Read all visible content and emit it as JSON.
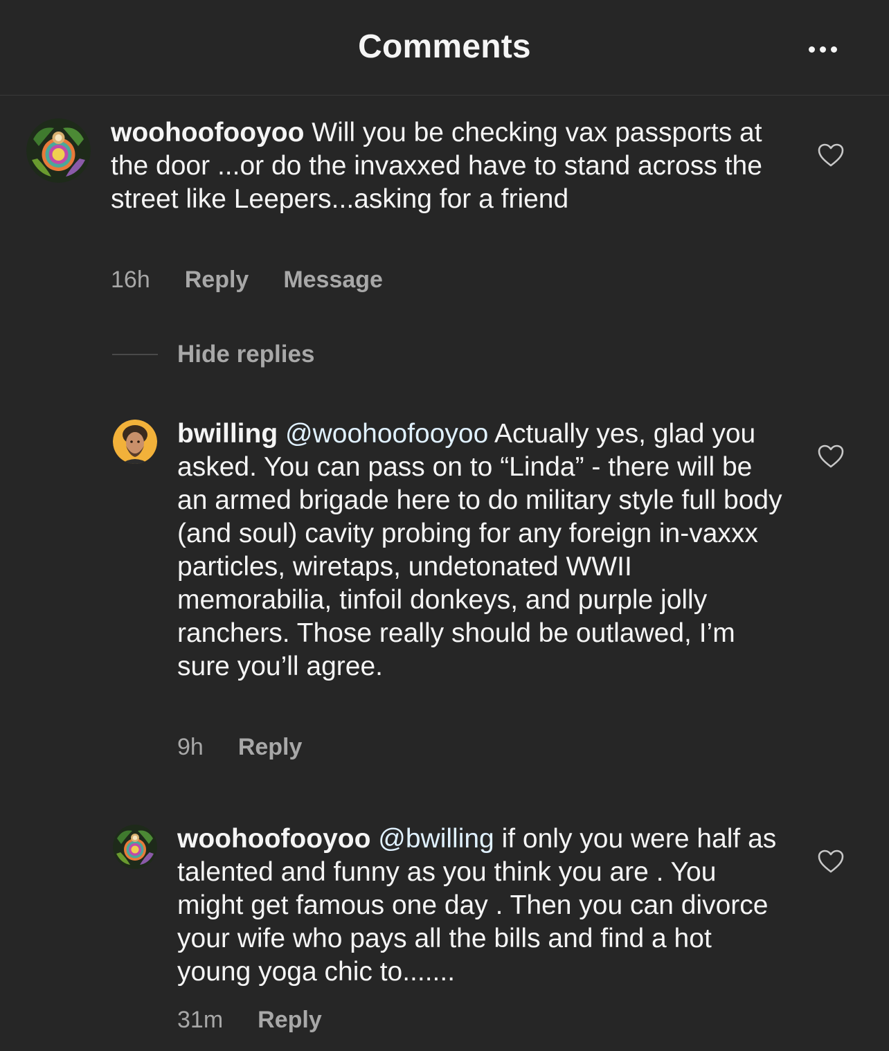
{
  "header": {
    "title": "Comments",
    "more_icon": "more-horizontal-icon"
  },
  "comments": [
    {
      "username": "woohoofooyoo",
      "mention": "",
      "text": " Will you be checking vax passports at the door ...or do the invaxxed have to stand across the street like Leepers...asking for a friend",
      "time": "16h",
      "reply_label": "Reply",
      "message_label": "Message",
      "like_icon": "heart-outline-icon"
    },
    {
      "username": "bwilling",
      "mention": "@woohoofooyoo",
      "text": " Actually yes, glad you asked. You can pass on to “Linda” - there will be an armed brigade here to do military style full body (and soul) cavity probing for any foreign in-vaxxx particles, wiretaps, undetonated WWII memorabilia, tinfoil donkeys, and purple jolly ranchers. Those really should be outlawed, I’m sure you’ll agree.",
      "time": "9h",
      "reply_label": "Reply",
      "like_icon": "heart-outline-icon"
    },
    {
      "username": "woohoofooyoo",
      "mention": "@bwilling",
      "text": " if only you were half as talented and funny as you think you are .  You might get famous one day . Then you can divorce your wife who pays all the bills and find a hot young yoga chic to.......",
      "time": "31m",
      "reply_label": "Reply",
      "like_icon": "heart-outline-icon"
    }
  ],
  "hide_replies_label": "Hide replies",
  "colors": {
    "background": "#262626",
    "text": "#f5f5f5",
    "secondary": "#a8a8a8",
    "mention": "#e0f1ff"
  }
}
